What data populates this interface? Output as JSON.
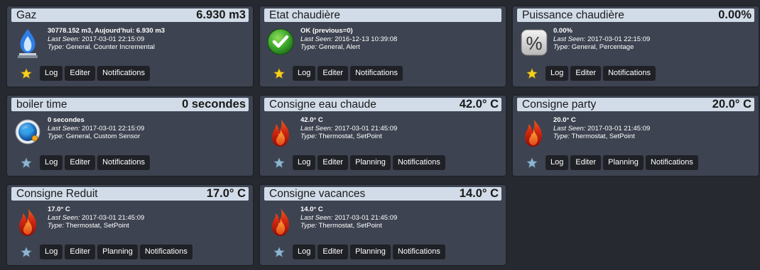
{
  "labels": {
    "last_seen": "Last Seen:",
    "type": "Type:"
  },
  "buttons": {
    "log": "Log",
    "editer": "Editer",
    "planning": "Planning",
    "notifications": "Notifications"
  },
  "cards": [
    {
      "name": "Gaz",
      "value": "6.930 m3",
      "data": "30778.152 m3, Aujourd'hui: 6.930 m3",
      "last_seen": "2017-03-01 22:15:09",
      "type": "General, Counter Incremental",
      "icon": "gas-flame-icon",
      "favorite": true
    },
    {
      "name": "Etat chaudière",
      "value": "",
      "data": "OK (previous=0)",
      "last_seen": "2016-12-13 10:39:08",
      "type": "General, Alert",
      "icon": "ok-check-icon",
      "favorite": true
    },
    {
      "name": "Puissance chaudière",
      "value": "0.00%",
      "data": "0.00%",
      "last_seen": "2017-03-01 22:15:09",
      "type": "General, Percentage",
      "icon": "percentage-icon",
      "favorite": true
    },
    {
      "name": "boiler time",
      "value": "0 secondes",
      "data": "0 secondes",
      "last_seen": "2017-03-01 22:15:09",
      "type": "General, Custom Sensor",
      "icon": "custom-sensor-icon",
      "favorite": false
    },
    {
      "name": "Consigne eau chaude",
      "value": "42.0° C",
      "data": "42.0° C",
      "last_seen": "2017-03-01 21:45:09",
      "type": "Thermostat, SetPoint",
      "icon": "flame-icon",
      "favorite": false
    },
    {
      "name": "Consigne party",
      "value": "20.0° C",
      "data": "20.0° C",
      "last_seen": "2017-03-01 21:45:09",
      "type": "Thermostat, SetPoint",
      "icon": "flame-icon",
      "favorite": false
    },
    {
      "name": "Consigne Reduit",
      "value": "17.0° C",
      "data": "17.0° C",
      "last_seen": "2017-03-01 21:45:09",
      "type": "Thermostat, SetPoint",
      "icon": "flame-icon",
      "favorite": false
    },
    {
      "name": "Consigne vacances",
      "value": "14.0° C",
      "data": "14.0° C",
      "last_seen": "2017-03-01 21:45:09",
      "type": "Thermostat, SetPoint",
      "icon": "flame-icon",
      "favorite": false
    }
  ],
  "colors": {
    "background": "#262930",
    "card": "#3d4350",
    "title_bar": "#d2dce9",
    "button": "#1f2127",
    "star_favorite": "#f5d020",
    "star_normal": "#8fb4cf"
  }
}
